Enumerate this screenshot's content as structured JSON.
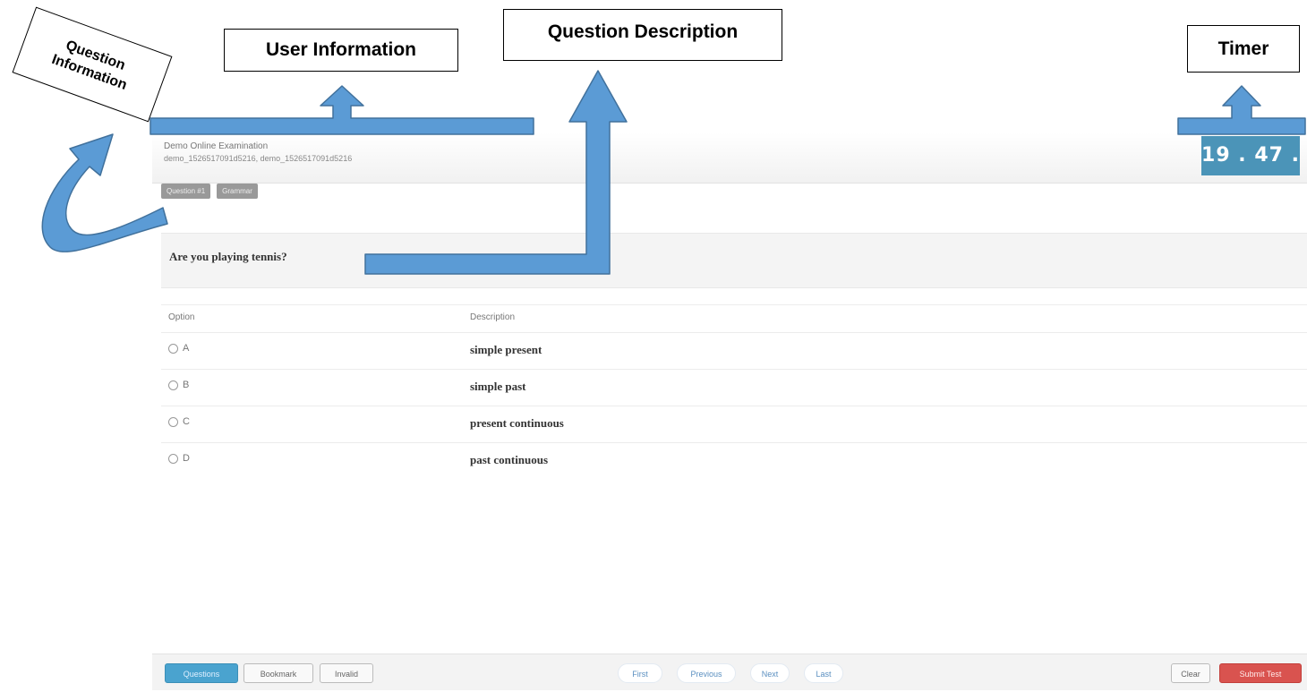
{
  "annotations": {
    "question_information": "Question\nInformation",
    "user_information": "User Information",
    "question_description": "Question Description",
    "timer": "Timer"
  },
  "header": {
    "exam_title": "Demo Online Examination",
    "user_info": "demo_1526517091d5216, demo_1526517091d5216"
  },
  "timer": {
    "display": "19 . 47 ."
  },
  "tags": [
    "Question #1",
    "Grammar"
  ],
  "question": {
    "text": "Are you playing tennis?"
  },
  "options_table": {
    "headers": {
      "option": "Option",
      "description": "Description"
    },
    "rows": [
      {
        "option": "A",
        "description": "simple present"
      },
      {
        "option": "B",
        "description": "simple past"
      },
      {
        "option": "C",
        "description": "present continuous"
      },
      {
        "option": "D",
        "description": "past continuous"
      }
    ]
  },
  "footer": {
    "questions": "Questions",
    "bookmark": "Bookmark",
    "invalid": "Invalid",
    "first": "First",
    "previous": "Previous",
    "next": "Next",
    "last": "Last",
    "clear": "Clear",
    "submit": "Submit Test"
  },
  "colors": {
    "timer_bg": "#4b94b8",
    "arrow_fill": "#5b9bd5",
    "arrow_stroke": "#41719c",
    "submit_bg": "#d9534f",
    "questions_bg": "#4aa3cf"
  }
}
